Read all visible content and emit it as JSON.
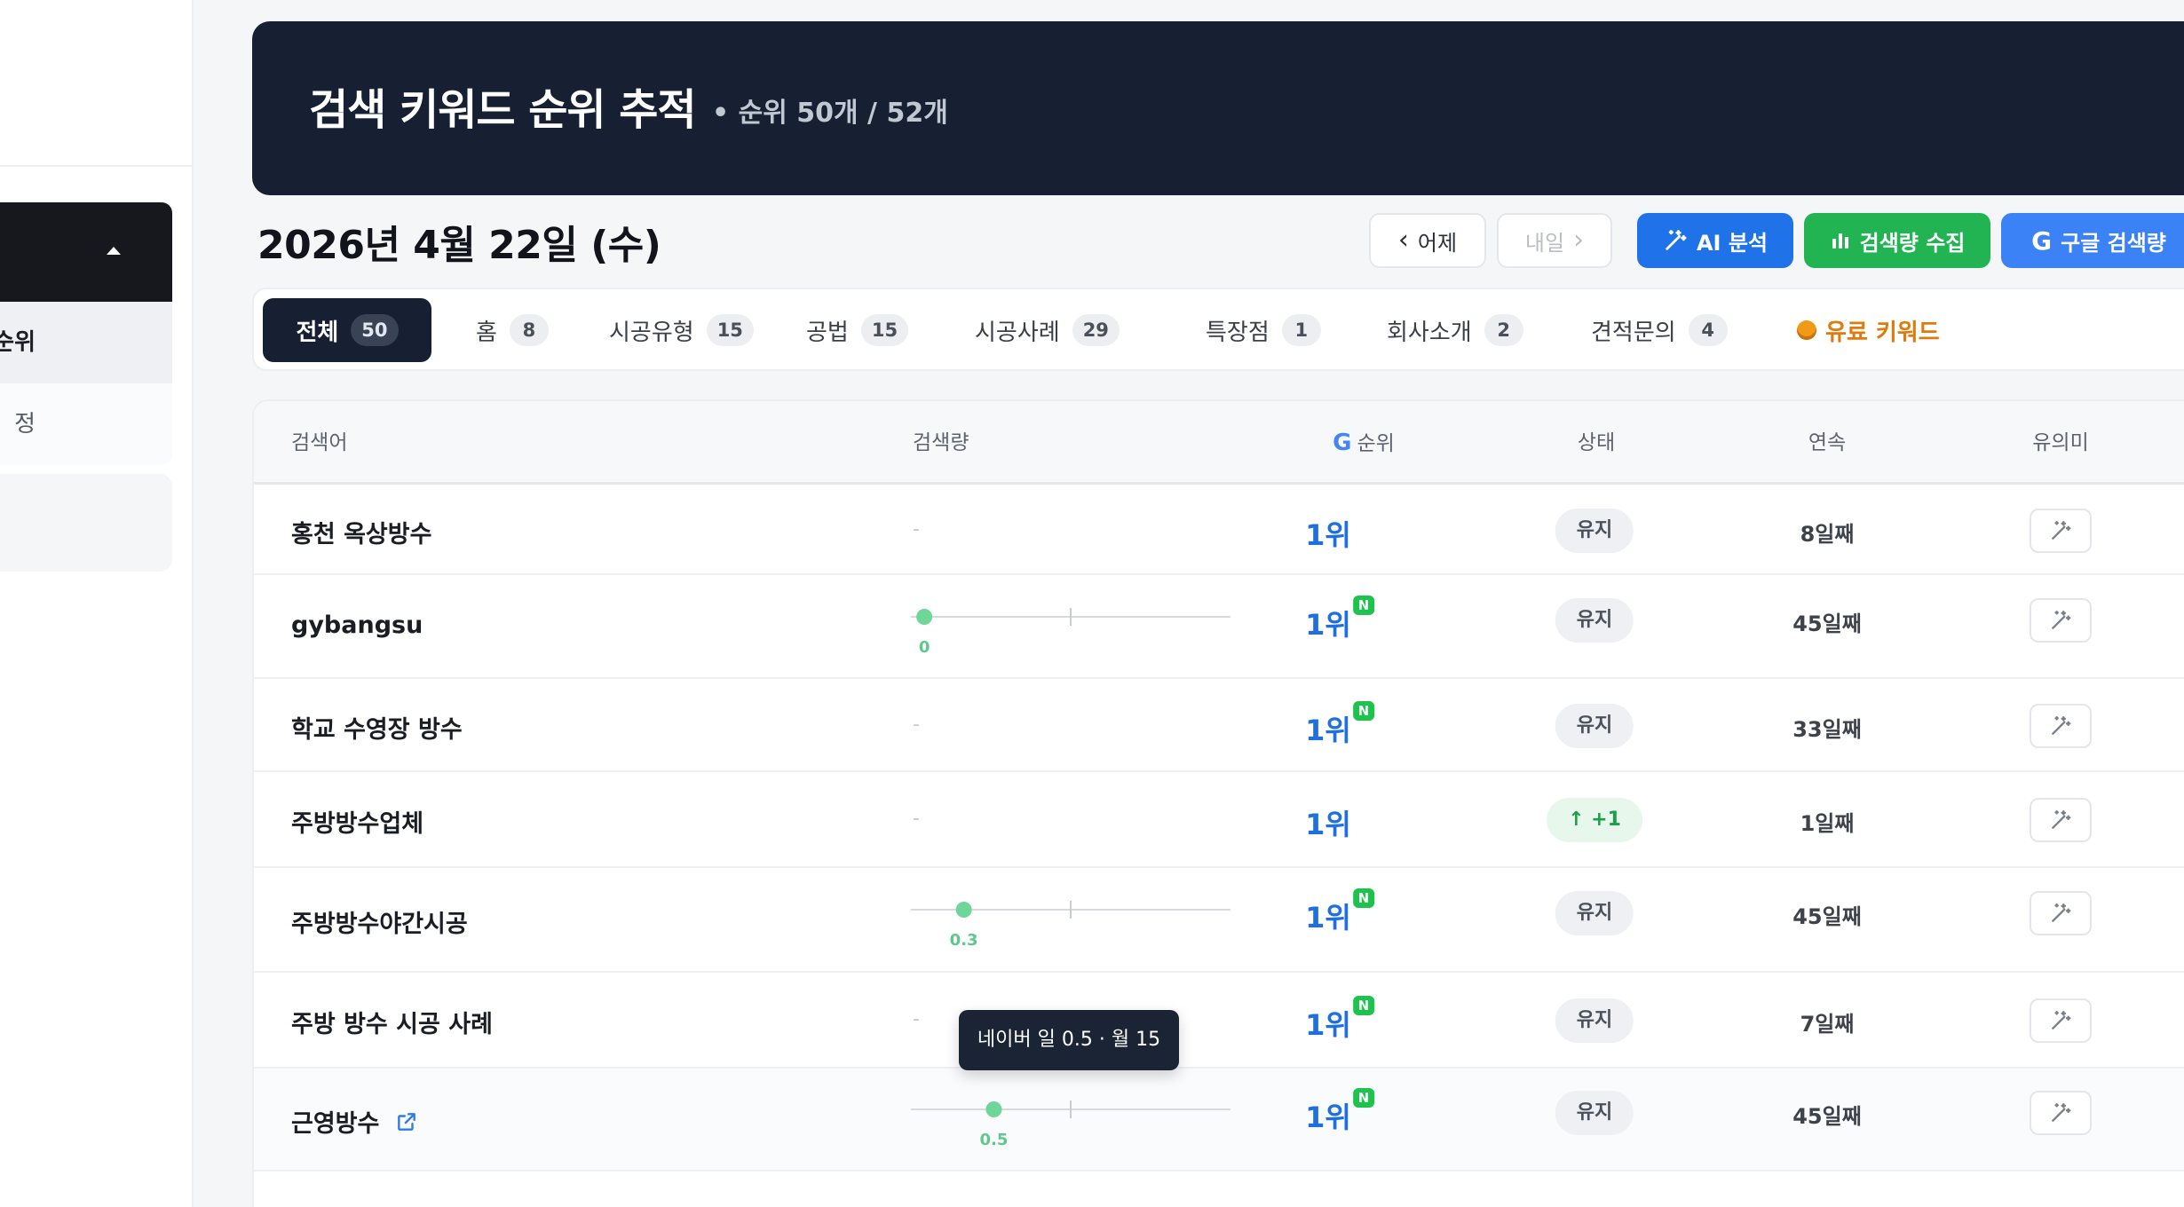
{
  "sidebar": {
    "items": [
      {
        "label": "순위",
        "active": true
      },
      {
        "label": "정",
        "active": false
      }
    ]
  },
  "header": {
    "title": "검색 키워드 순위 추적",
    "subtitle": "• 순위 50개 / 52개"
  },
  "date_title": "2026년 4월 22일 (수)",
  "toolbar": {
    "prev_label": "어제",
    "next_label": "내일",
    "ai_label": "AI 분석",
    "volume_label": "검색량 수집",
    "google_label": "구글 검색량"
  },
  "tabs": [
    {
      "label": "전체",
      "count": "50",
      "active": true
    },
    {
      "label": "홈",
      "count": "8"
    },
    {
      "label": "시공유형",
      "count": "15"
    },
    {
      "label": "공법",
      "count": "15"
    },
    {
      "label": "시공사례",
      "count": "29"
    },
    {
      "label": "특장점",
      "count": "1"
    },
    {
      "label": "회사소개",
      "count": "2"
    },
    {
      "label": "견적문의",
      "count": "4"
    },
    {
      "label": "유료 키워드",
      "paid": true
    }
  ],
  "table": {
    "columns": [
      "검색어",
      "검색량",
      "순위",
      "상태",
      "연속",
      "유의미"
    ],
    "rows": [
      {
        "keyword": "홍천 옥상방수",
        "volume": "-",
        "rank": "1위",
        "naver": false,
        "status": "유지",
        "streak": "8일째"
      },
      {
        "keyword": "gybangsu",
        "volume": "0",
        "volume_frac": 0.02,
        "rank": "1위",
        "naver": true,
        "status": "유지",
        "streak": "45일째"
      },
      {
        "keyword": "학교 수영장 방수",
        "volume": "-",
        "rank": "1위",
        "naver": true,
        "status": "유지",
        "streak": "33일째"
      },
      {
        "keyword": "주방방수업체",
        "volume": "-",
        "rank": "1위",
        "naver": false,
        "status": "+1",
        "status_up": true,
        "streak": "1일째"
      },
      {
        "keyword": "주방방수야간시공",
        "volume": "0.3",
        "volume_frac": 0.145,
        "rank": "1위",
        "naver": true,
        "status": "유지",
        "streak": "45일째"
      },
      {
        "keyword": "주방 방수 시공 사례",
        "volume": "-",
        "rank": "1위",
        "naver": true,
        "status": "유지",
        "streak": "7일째"
      },
      {
        "keyword": "근영방수",
        "volume": "0.5",
        "volume_frac": 0.24,
        "rank": "1위",
        "naver": true,
        "status": "유지",
        "streak": "45일째",
        "external_link": true
      }
    ]
  },
  "tooltip": "네이버 일 0.5 · 월 15",
  "colors": {
    "navy": "#162032",
    "accent_blue": "#1f72e8",
    "green": "#22b453",
    "paid_orange": "#e07a0c",
    "naver_green": "#1ec34d"
  }
}
